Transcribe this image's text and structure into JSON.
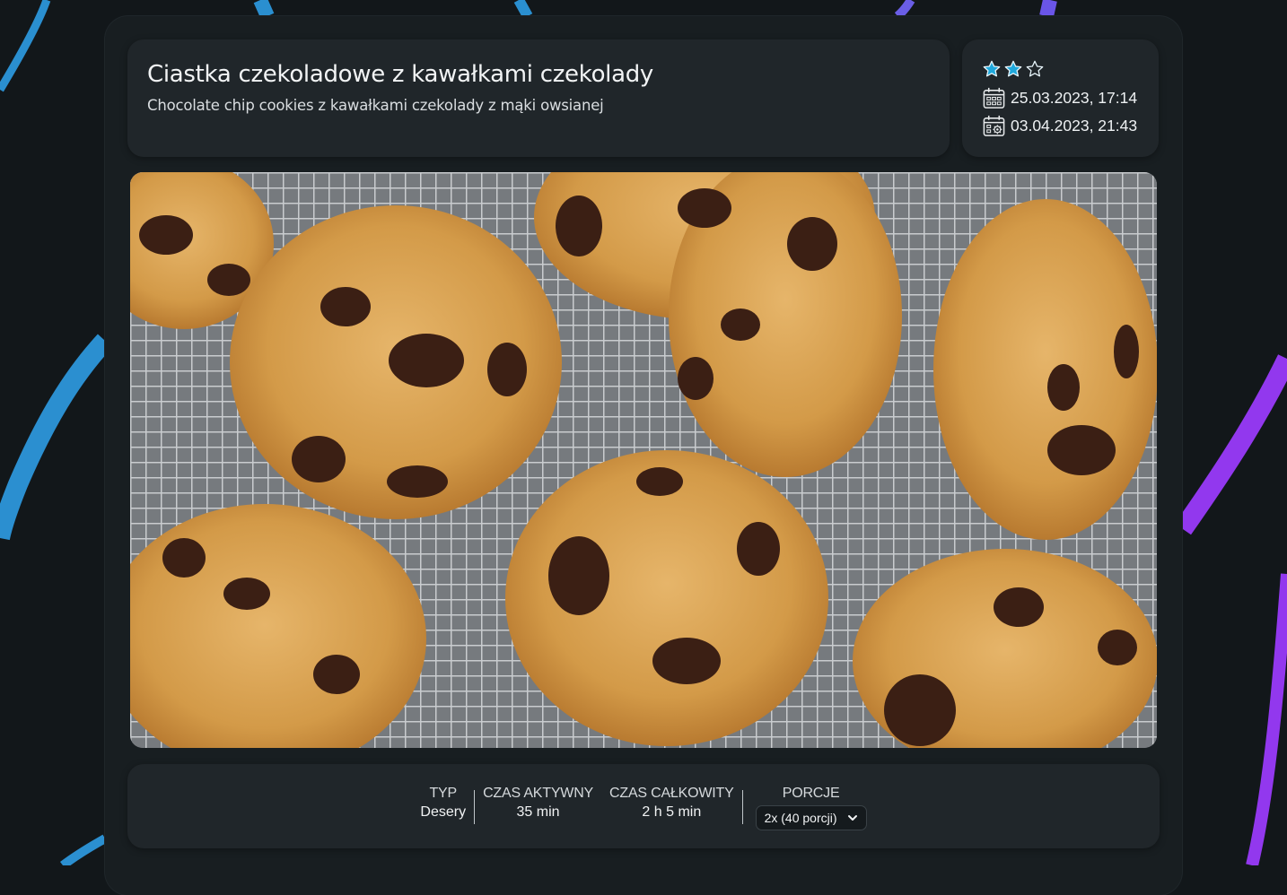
{
  "recipe": {
    "title": "Ciastka czekoladowe z kawałkami czekolady",
    "subtitle": "Chocolate chip cookies z kawałkami czekolady z mąki owsianej"
  },
  "meta": {
    "rating": 2,
    "rating_max": 3,
    "star_color": "#1fa8dc",
    "created": "25.03.2023, 17:14",
    "modified": "03.04.2023, 21:43",
    "created_icon": "calendar-icon",
    "modified_icon": "calendar-gear-icon"
  },
  "image": {
    "description_icon": "cookies-photo"
  },
  "info": {
    "type_label": "TYP",
    "type_value": "Desery",
    "active_label": "CZAS AKTYWNY",
    "active_value": "35 min",
    "total_label": "CZAS CAŁKOWITY",
    "total_value": "2 h 5 min",
    "portions_label": "PORCJE",
    "portions_selected": "2x (40 porcji)"
  },
  "colors": {
    "background": "#12171a",
    "card": "#181e21",
    "panel": "#20262a",
    "accent_blue": "#1e8fd0",
    "accent_purple": "#8b3ff0"
  }
}
